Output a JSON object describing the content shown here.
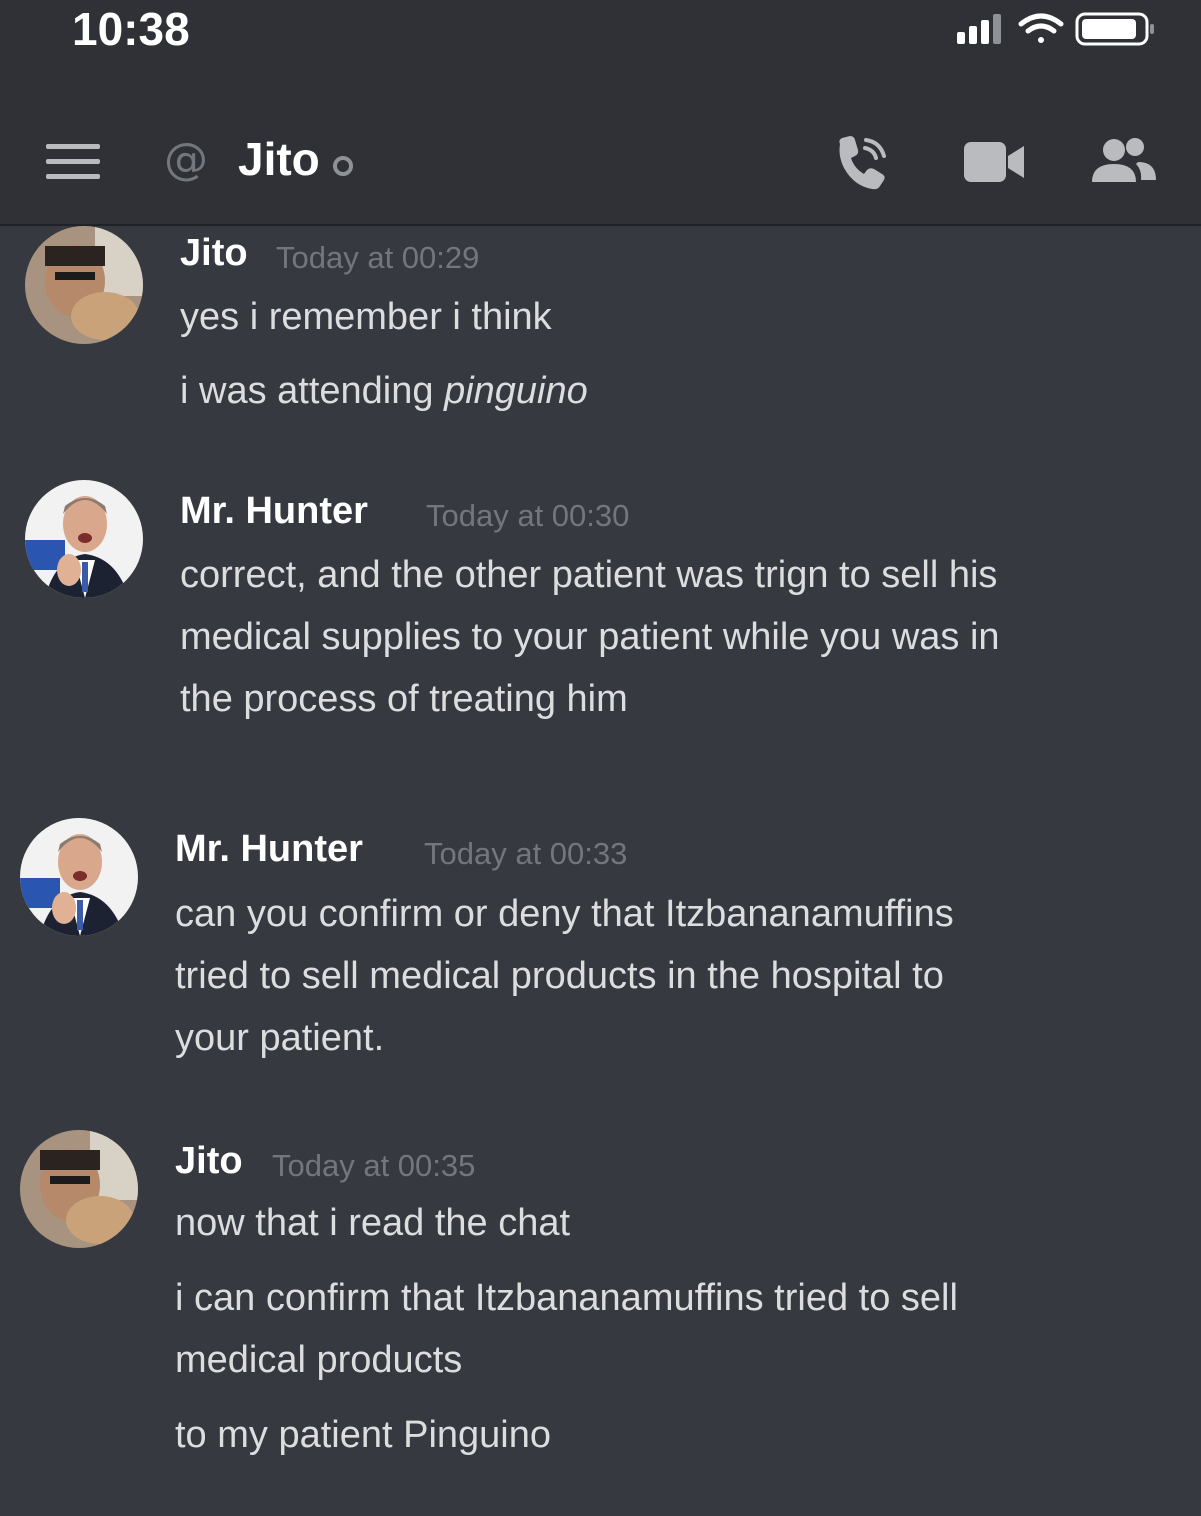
{
  "status_bar": {
    "time": "10:38"
  },
  "header": {
    "at_symbol": "@",
    "channel_name": "Jito",
    "icons": [
      "menu-icon",
      "at-icon",
      "presence-indicator",
      "call-icon",
      "video-icon",
      "members-icon"
    ]
  },
  "messages": [
    {
      "author": "Jito",
      "timestamp": "Today at 00:29",
      "avatar": "jito-avatar",
      "lines": [
        "yes i remember i think"
      ],
      "line2_prefix": "i was attending ",
      "line2_italic": "pinguino"
    },
    {
      "author": "Mr. Hunter",
      "timestamp": "Today at 00:30",
      "avatar": "hunter-avatar",
      "lines": [
        "correct, and the other patient was trign to sell his",
        "medical supplies to your patient while you was in",
        "the process of treating him"
      ]
    },
    {
      "author": "Mr. Hunter",
      "timestamp": "Today at 00:33",
      "avatar": "hunter-avatar",
      "lines": [
        "can you confirm or deny that Itzbananamuffins",
        "tried to sell medical products in the hospital to",
        "your patient."
      ]
    },
    {
      "author": "Jito",
      "timestamp": "Today at 00:35",
      "avatar": "jito-avatar",
      "lines": [
        "now that i read the chat",
        "i can confirm that Itzbananamuffins tried to sell",
        "medical products",
        "to my patient Pinguino"
      ]
    }
  ],
  "colors": {
    "background": "#36393f",
    "header": "#2f3136",
    "text": "#dcddde",
    "muted": "#72767d"
  }
}
